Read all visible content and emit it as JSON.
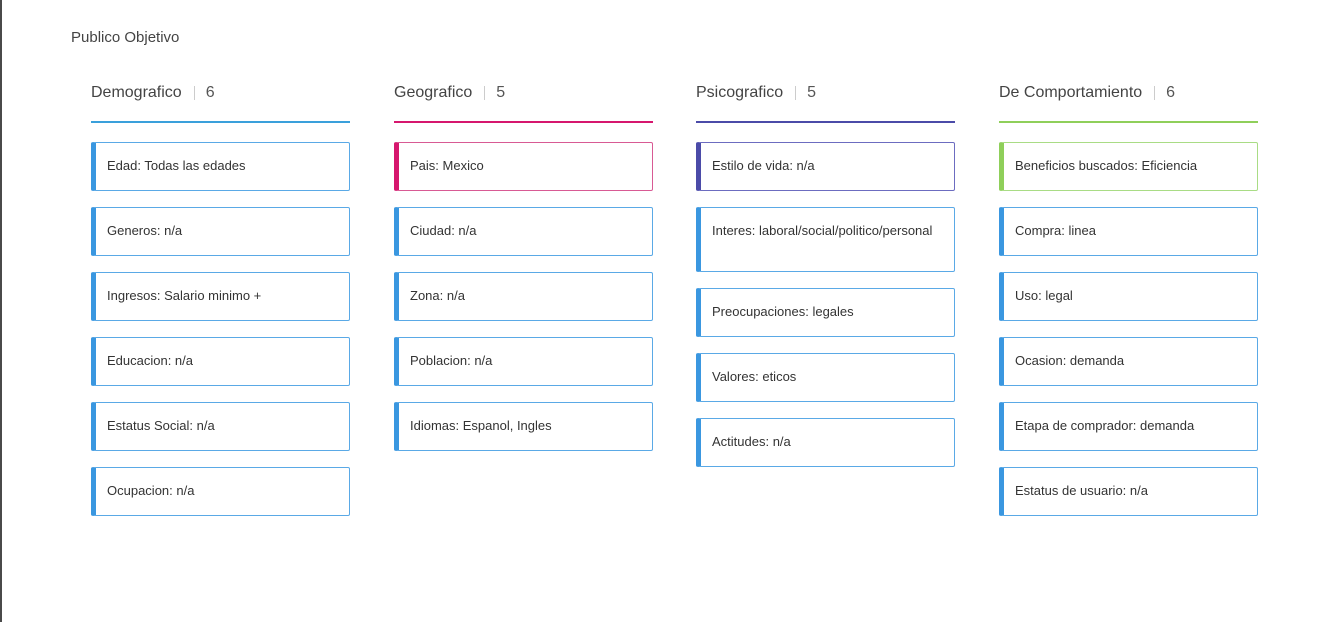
{
  "page": {
    "title": "Publico Objetivo"
  },
  "colors": {
    "demografico": "#3aa0db",
    "geografico": "#d6176e",
    "psicografico": "#4b4ba8",
    "comportamiento": "#8fcf5a",
    "card_border_default": "#5aa9e6",
    "card_accent_default": "#3a97e0"
  },
  "columns": [
    {
      "title": "Demografico",
      "count": "6",
      "cards": [
        {
          "text": "Edad: Todas las edades"
        },
        {
          "text": "Generos: n/a"
        },
        {
          "text": "Ingresos: Salario minimo +"
        },
        {
          "text": "Educacion: n/a"
        },
        {
          "text": "Estatus Social: n/a"
        },
        {
          "text": "Ocupacion: n/a"
        }
      ]
    },
    {
      "title": "Geografico",
      "count": "5",
      "cards": [
        {
          "text": "Pais: Mexico"
        },
        {
          "text": "Ciudad: n/a"
        },
        {
          "text": "Zona:  n/a"
        },
        {
          "text": "Poblacion: n/a"
        },
        {
          "text": "Idiomas: Espanol, Ingles"
        }
      ]
    },
    {
      "title": "Psicografico",
      "count": "5",
      "cards": [
        {
          "text": "Estilo de vida: n/a"
        },
        {
          "text": "Interes: laboral/social/politico/personal"
        },
        {
          "text": "Preocupaciones: legales"
        },
        {
          "text": "Valores: eticos"
        },
        {
          "text": "Actitudes: n/a"
        }
      ]
    },
    {
      "title": "De Comportamiento",
      "count": "6",
      "cards": [
        {
          "text": "Beneficios buscados: Eficiencia"
        },
        {
          "text": "Compra: linea"
        },
        {
          "text": "Uso: legal"
        },
        {
          "text": "Ocasion: demanda"
        },
        {
          "text": "Etapa de comprador: demanda"
        },
        {
          "text": "Estatus de usuario: n/a"
        }
      ]
    }
  ]
}
